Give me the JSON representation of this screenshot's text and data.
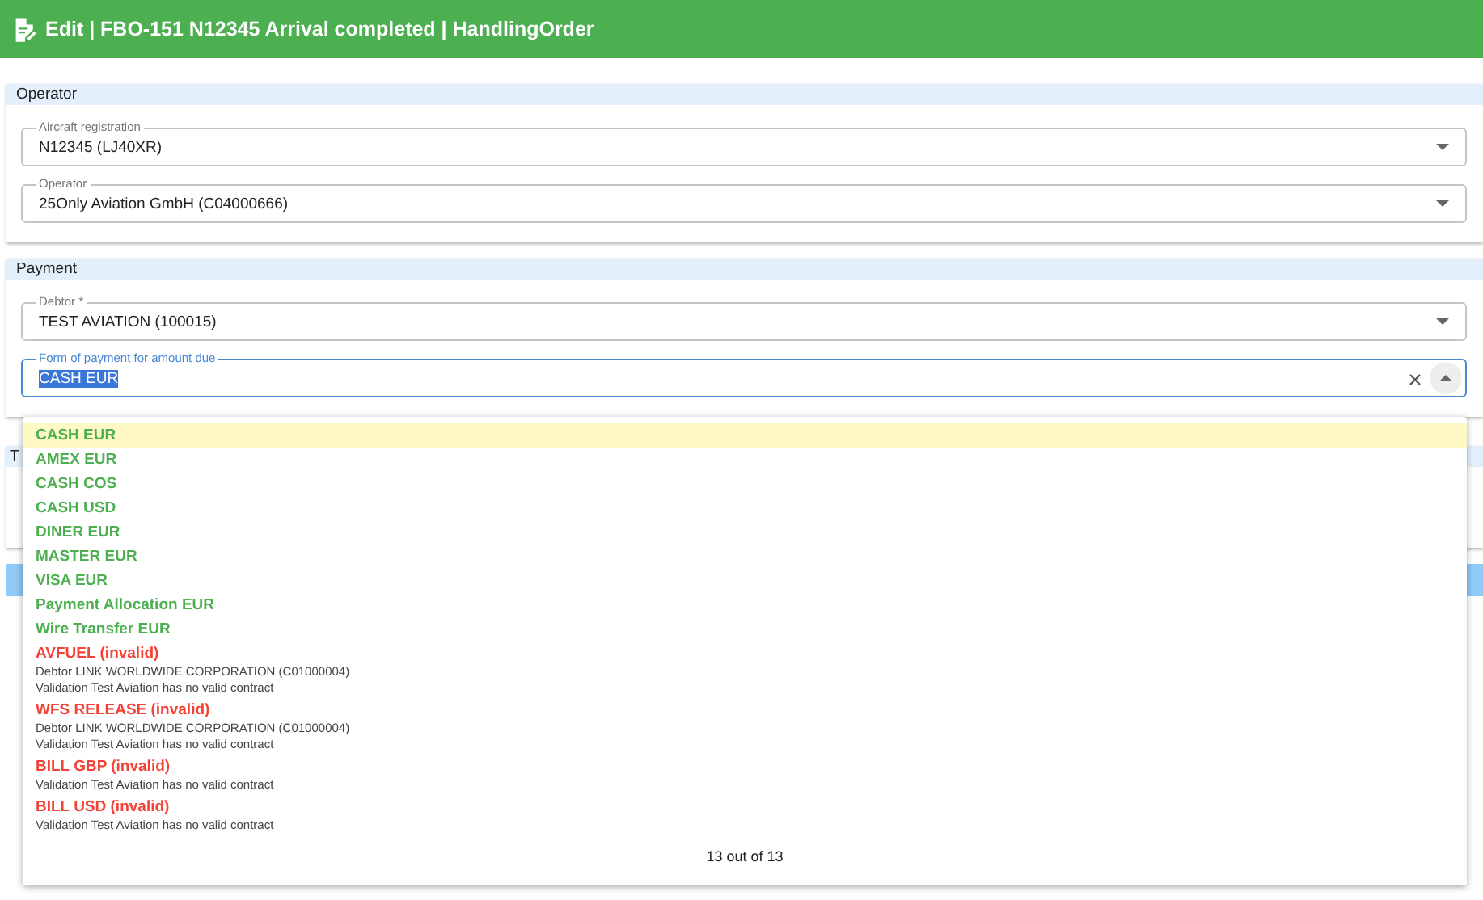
{
  "window": {
    "title": "Edit | FBO-151 N12345 Arrival completed | HandlingOrder"
  },
  "sections": [
    {
      "title": "Operator",
      "fields": [
        {
          "label": "Aircraft registration",
          "value": "N12345 (LJ40XR)",
          "focused": false
        },
        {
          "label": "Operator",
          "value": "25Only Aviation GmbH (C04000666)",
          "focused": false
        }
      ]
    },
    {
      "title": "Payment",
      "fields": [
        {
          "label": "Debtor *",
          "value": "TEST AVIATION (100015)",
          "focused": false
        },
        {
          "label": "Form of payment for amount due",
          "value": "CASH EUR",
          "focused": true
        }
      ]
    },
    {
      "title": "T"
    }
  ],
  "dropdown": {
    "options": [
      {
        "label": "CASH EUR",
        "kind": "valid",
        "selected": true
      },
      {
        "label": "AMEX EUR",
        "kind": "valid",
        "selected": false
      },
      {
        "label": "CASH COS",
        "kind": "valid",
        "selected": false
      },
      {
        "label": "CASH USD",
        "kind": "valid",
        "selected": false
      },
      {
        "label": "DINER EUR",
        "kind": "valid",
        "selected": false
      },
      {
        "label": "MASTER EUR",
        "kind": "valid",
        "selected": false
      },
      {
        "label": "VISA EUR",
        "kind": "valid",
        "selected": false
      },
      {
        "label": "Payment Allocation EUR",
        "kind": "valid",
        "selected": false
      },
      {
        "label": "Wire Transfer EUR",
        "kind": "valid",
        "selected": false
      },
      {
        "label": "AVFUEL (invalid)",
        "kind": "invalid",
        "selected": false,
        "details": [
          "Debtor LINK WORLDWIDE CORPORATION (C01000004)",
          "Validation Test Aviation has no valid contract"
        ]
      },
      {
        "label": "WFS RELEASE (invalid)",
        "kind": "invalid",
        "selected": false,
        "details": [
          "Debtor LINK WORLDWIDE CORPORATION (C01000004)",
          "Validation Test Aviation has no valid contract"
        ]
      },
      {
        "label": "BILL GBP (invalid)",
        "kind": "invalid",
        "selected": false,
        "details": [
          "Validation Test Aviation has no valid contract"
        ]
      },
      {
        "label": "BILL USD (invalid)",
        "kind": "invalid",
        "selected": false,
        "details": [
          "Validation Test Aviation has no valid contract"
        ]
      }
    ],
    "count": "13 out of 13"
  }
}
